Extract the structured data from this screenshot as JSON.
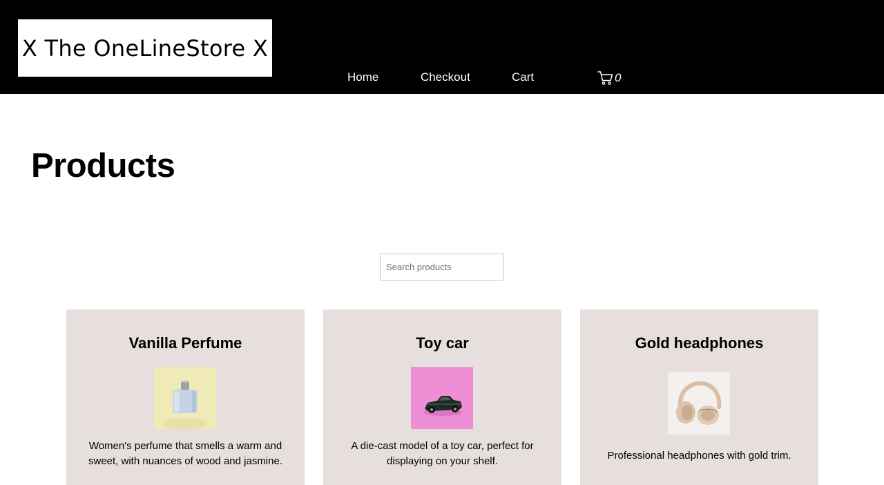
{
  "header": {
    "logo_text": "X The OneLineStore X",
    "nav": [
      {
        "label": "Home"
      },
      {
        "label": "Checkout"
      },
      {
        "label": "Cart"
      }
    ],
    "cart_count": "0",
    "cart_icon": "shopping-cart-icon"
  },
  "main": {
    "title": "Products",
    "search": {
      "placeholder": "Search products",
      "value": ""
    },
    "products": [
      {
        "name": "Vanilla Perfume",
        "description": "Women's perfume that smells a warm and sweet, with nuances of wood and jasmine.",
        "image": "perfume-bottle-image",
        "image_bg": "#f0ebb6"
      },
      {
        "name": "Toy car",
        "description": "A die-cast model of a toy car, perfect for displaying on your shelf.",
        "image": "toy-car-image",
        "image_bg": "#ee8fd6"
      },
      {
        "name": "Gold headphones",
        "description": "Professional headphones with gold trim.",
        "image": "headphones-image",
        "image_bg": "#f3f0ed"
      }
    ]
  },
  "colors": {
    "header_bg": "#000000",
    "card_bg": "#e6dfdd",
    "text": "#000000"
  }
}
